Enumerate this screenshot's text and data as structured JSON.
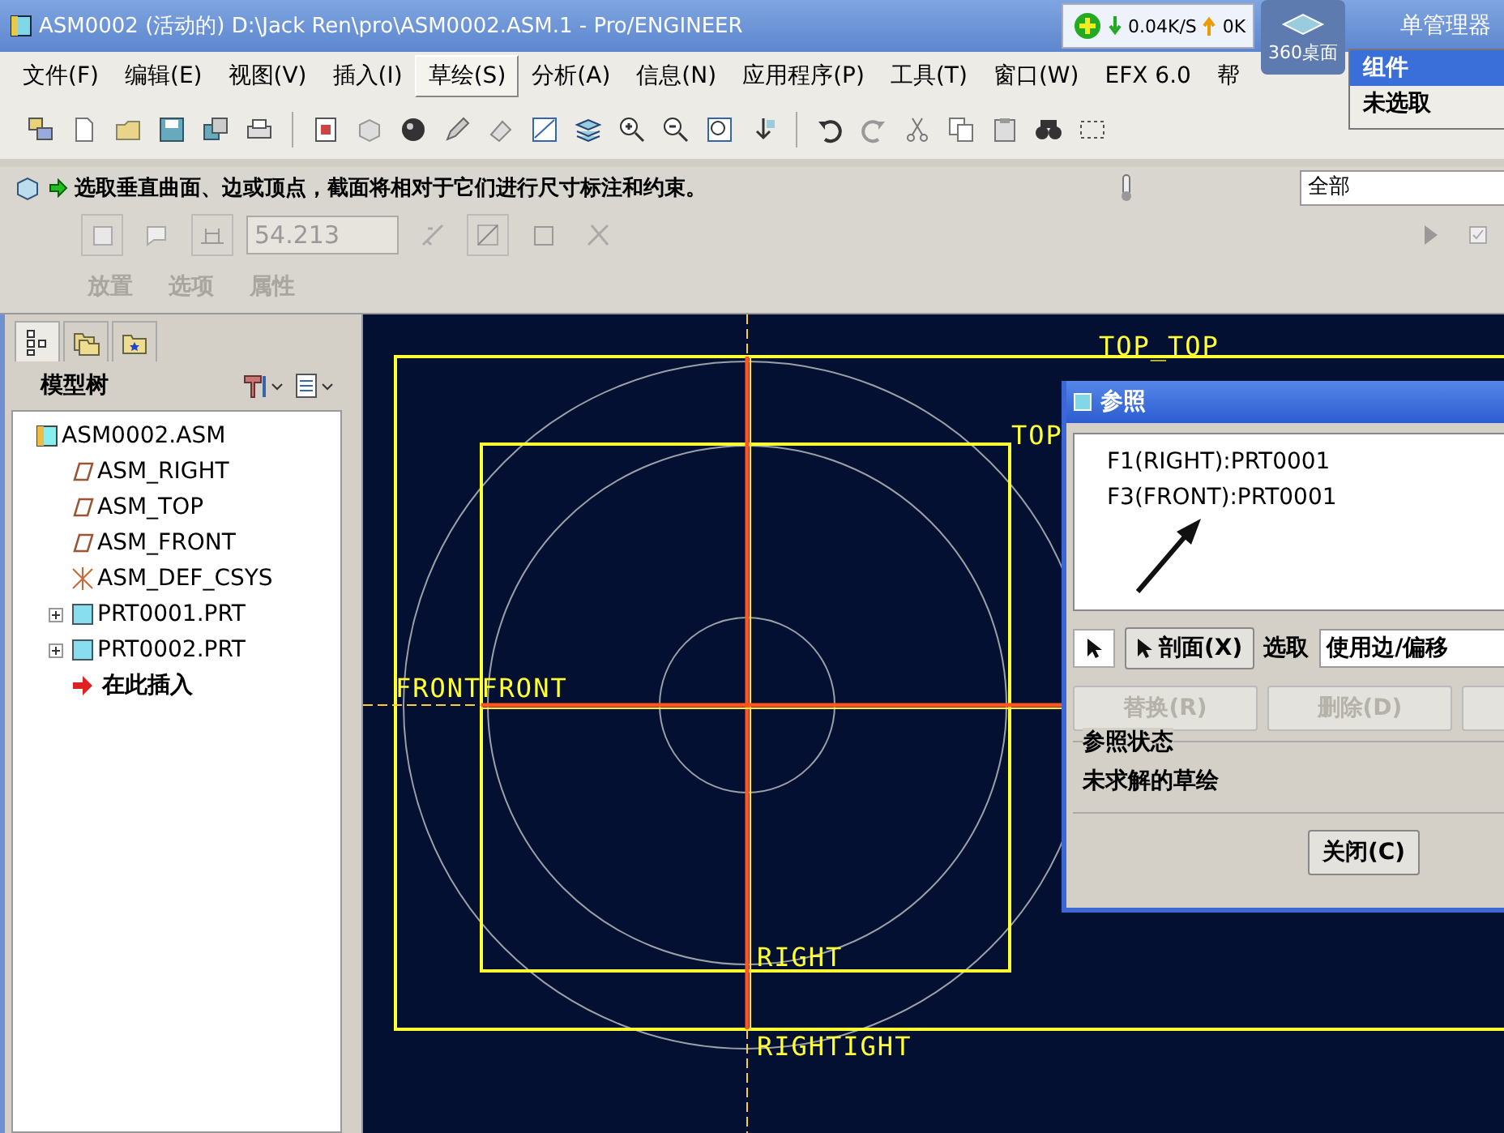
{
  "window": {
    "title": "ASM0002 (活动的) D:\\Jack Ren\\pro\\ASM0002.ASM.1 - Pro/ENGINEER"
  },
  "tray": {
    "download": "0.04K/S",
    "upload": "0K",
    "widget_label": "360桌面",
    "partial_title": "单管理器"
  },
  "popup": {
    "items": [
      {
        "label": "组件",
        "selected": true
      },
      {
        "label": "未选取",
        "selected": false
      }
    ]
  },
  "menu": [
    {
      "label": "文件(F)",
      "selected": false
    },
    {
      "label": "编辑(E)",
      "selected": false
    },
    {
      "label": "视图(V)",
      "selected": false
    },
    {
      "label": "插入(I)",
      "selected": false
    },
    {
      "label": "草绘(S)",
      "selected": true
    },
    {
      "label": "分析(A)",
      "selected": false
    },
    {
      "label": "信息(N)",
      "selected": false
    },
    {
      "label": "应用程序(P)",
      "selected": false
    },
    {
      "label": "工具(T)",
      "selected": false
    },
    {
      "label": "窗口(W)",
      "selected": false
    },
    {
      "label": "EFX 6.0",
      "selected": false
    },
    {
      "label": "帮",
      "selected": false
    }
  ],
  "prompt": {
    "text": "选取垂直曲面、边或顶点，截面将相对于它们进行尺寸标注和约束。"
  },
  "filter": {
    "value": "全部"
  },
  "dashboard": {
    "value": "54.213",
    "tabs": [
      {
        "label": "放置",
        "disabled": true
      },
      {
        "label": "选项",
        "disabled": true
      },
      {
        "label": "属性",
        "disabled": true
      }
    ]
  },
  "model_tree": {
    "title": "模型树",
    "items": [
      {
        "label": "ASM0002.ASM",
        "kind": "assembly",
        "children": [
          {
            "label": "ASM_RIGHT",
            "kind": "plane"
          },
          {
            "label": "ASM_TOP",
            "kind": "plane"
          },
          {
            "label": "ASM_FRONT",
            "kind": "plane"
          },
          {
            "label": "ASM_DEF_CSYS",
            "kind": "csys"
          },
          {
            "label": "PRT0001.PRT",
            "kind": "part",
            "expanded": false
          },
          {
            "label": "PRT0002.PRT",
            "kind": "part",
            "expanded": false
          },
          {
            "label": "在此插入",
            "kind": "insert"
          }
        ]
      }
    ]
  },
  "canvas": {
    "labels": [
      "TOP_TOP",
      "TOP",
      "FRONTFRONT",
      "RIGHT",
      "RIGHTIGHT"
    ]
  },
  "dialog": {
    "title": "参照",
    "references": [
      "F1(RIGHT):PRT0001",
      "F3(FRONT):PRT0001"
    ],
    "section_button": "剖面(X)",
    "select_label": "选取",
    "select_value": "使用边/偏移",
    "buttons": [
      {
        "label": "替换(R)",
        "disabled": true
      },
      {
        "label": "删除(D)",
        "disabled": true
      }
    ],
    "status_label": "参照状态",
    "status": "未求解的草绘",
    "close": "关闭(C)"
  }
}
